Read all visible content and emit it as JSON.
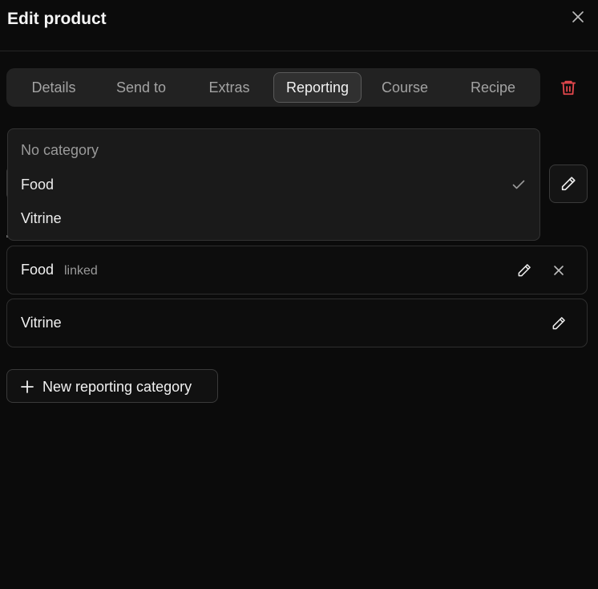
{
  "header": {
    "title": "Edit product"
  },
  "tabs": [
    {
      "label": "Details"
    },
    {
      "label": "Send to"
    },
    {
      "label": "Extras"
    },
    {
      "label": "Reporting",
      "active": true
    },
    {
      "label": "Course"
    },
    {
      "label": "Recipe"
    }
  ],
  "dropdown": {
    "options": [
      {
        "label": "No category"
      },
      {
        "label": "Food",
        "selected": true
      },
      {
        "label": "Vitrine"
      }
    ]
  },
  "categories": [
    {
      "name": "Food",
      "badge": "linked"
    },
    {
      "name": "Vitrine"
    }
  ],
  "new_button": {
    "label": "New reporting category"
  },
  "icons": {
    "close": "close-icon",
    "delete": "trash-icon",
    "edit": "pencil-icon",
    "check": "check-icon",
    "unlink": "x-icon",
    "add": "plus-icon"
  },
  "colors": {
    "background": "#0b0b0b",
    "tab_bar": "#222222",
    "tab_active": "#303030",
    "danger": "#e5484d",
    "text": "#ededed",
    "muted": "#9a9a9a"
  }
}
